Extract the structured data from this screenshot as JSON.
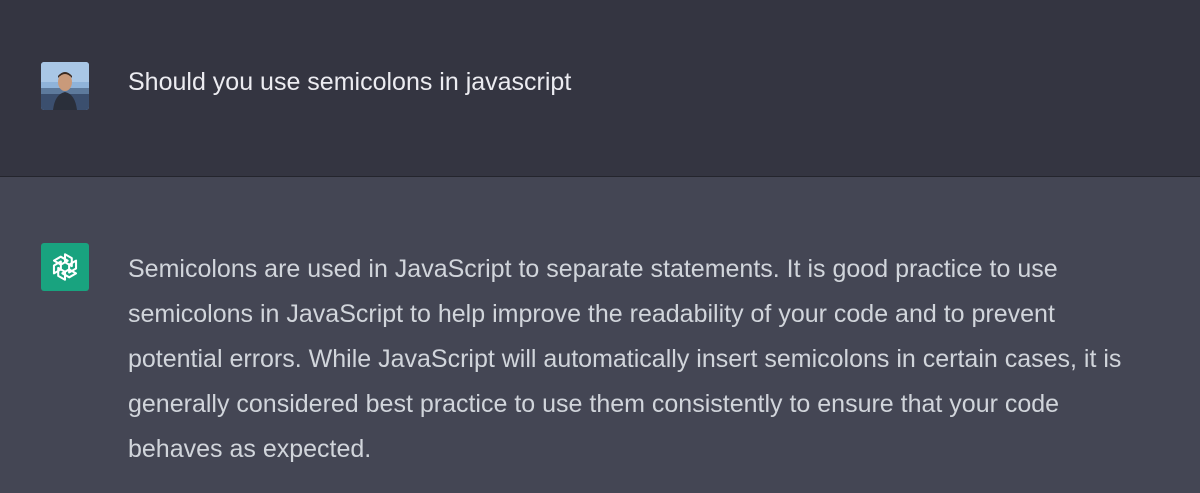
{
  "user": {
    "avatar_icon": "user-photo-avatar",
    "message": "Should you use semicolons in javascript"
  },
  "assistant": {
    "avatar_icon": "openai-logo-icon",
    "avatar_color": "#19a37f",
    "message_lines": [
      "Semicolons are used in JavaScript to separate statements. It is good practice to use",
      "semicolons in JavaScript to help improve the readability of your code and to prevent",
      "potential errors. While JavaScript will automatically insert semicolons in certain cases, it is",
      "generally considered best practice to use them consistently to ensure that your code",
      "behaves as expected."
    ]
  },
  "colors": {
    "user_bg": "#343541",
    "assistant_bg": "#444654",
    "user_text": "#ececf1",
    "assistant_text": "#d1d5db"
  }
}
